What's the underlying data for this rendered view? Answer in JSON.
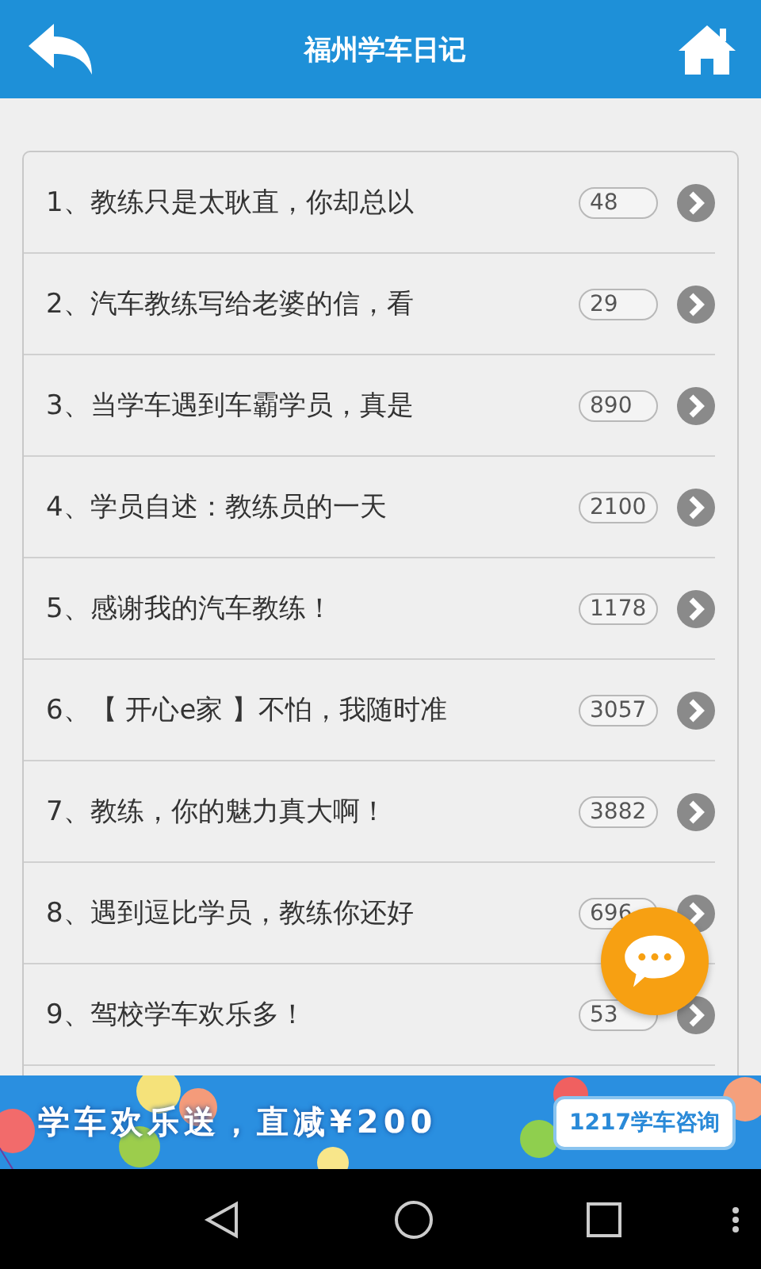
{
  "header": {
    "title": "福州学车日记"
  },
  "articles": [
    {
      "title": "1、教练只是太耿直，你却总以",
      "count": "48"
    },
    {
      "title": "2、汽车教练写给老婆的信，看",
      "count": "29"
    },
    {
      "title": "3、当学车遇到车霸学员，真是",
      "count": "890"
    },
    {
      "title": "4、学员自述：教练员的一天",
      "count": "2100"
    },
    {
      "title": "5、感谢我的汽车教练！",
      "count": "1178"
    },
    {
      "title": "6、【 开心e家 】不怕，我随时准",
      "count": "3057"
    },
    {
      "title": "7、教练，你的魅力真大啊！",
      "count": "3882"
    },
    {
      "title": "8、遇到逗比学员，教练你还好",
      "count": "696"
    },
    {
      "title": "9、驾校学车欢乐多！",
      "count": "53"
    }
  ],
  "banner": {
    "slogan": "学车欢乐送，直减¥200",
    "button": "1217学车咨询"
  }
}
